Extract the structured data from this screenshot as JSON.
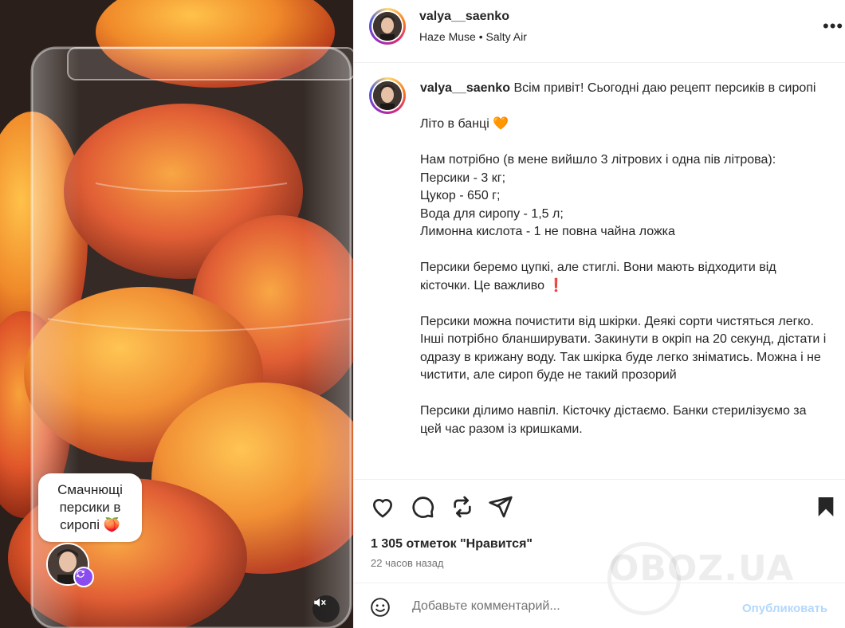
{
  "post": {
    "username": "valya__saenko",
    "audio_artist": "Haze Muse",
    "audio_separator": "•",
    "audio_title": "Salty Air",
    "more_label": "•••"
  },
  "media": {
    "bubble_text": "Смачнющі персики в сиропі 🍑",
    "mute_icon": "speaker-muted-icon"
  },
  "caption": {
    "username": "valya__saenko",
    "text": "Всім привіт! Сьогодні даю рецепт персиків в сиропі\n\nЛіто в банці 🧡\n\nНам потрібно (в мене вийшло 3 літрових і одна пів літрова):\nПерсики - 3 кг;\nЦукор - 650 г;\nВода для сиропу - 1,5 л;\nЛимонна кислота - 1 не повна чайна ложка\n\nПерсики беремо цупкі, але стиглі. Вони мають відходити від кісточки. Це важливо ❗\n\nПерсики можна почистити від шкірки. Деякі сорти чистяться легко. Інші потрібно бланширувати. Закинути в окріп на 20 секунд, дістати і одразу в крижану воду. Так шкірка буде легко зніматись. Можна і не чистити, але сироп буде не такий прозорий\n\nПерсики ділимо навпіл. Кісточку дістаємо. Банки стерилізуємо за цей час разом із кришками."
  },
  "actions": {
    "icons": [
      "heart-icon",
      "comment-icon",
      "repost-icon",
      "share-icon",
      "bookmark-icon"
    ],
    "likes_text": "1 305 отметок \"Нравится\"",
    "time_text": "22 часов назад"
  },
  "comment": {
    "placeholder": "Добавьте комментарий...",
    "publish_label": "Опубликовать"
  },
  "watermark": {
    "text": "OBOZ.UA"
  },
  "colors": {
    "publish_disabled": "#b3d8fd",
    "remix_badge": "#8a4cf0"
  }
}
